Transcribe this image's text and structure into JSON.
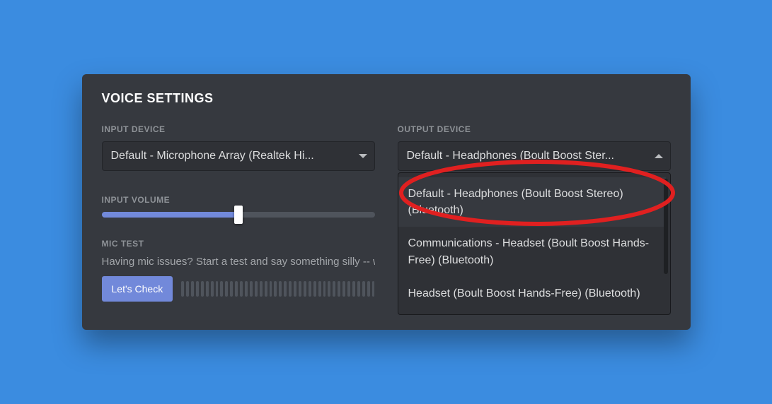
{
  "title": "VOICE SETTINGS",
  "input": {
    "label": "INPUT DEVICE",
    "selected": "Default - Microphone Array (Realtek Hi..."
  },
  "output": {
    "label": "OUTPUT DEVICE",
    "selected": "Default - Headphones (Boult Boost Ster...",
    "options": [
      "Default - Headphones (Boult Boost Stereo) (Bluetooth)",
      "Communications - Headset (Boult Boost Hands-Free) (Bluetooth)",
      "Headset (Boult Boost Hands-Free) (Bluetooth)"
    ]
  },
  "input_volume": {
    "label": "INPUT VOLUME",
    "percent": 50
  },
  "mic_test": {
    "label": "MIC TEST",
    "help": "Having mic issues? Start a test and say something silly -- w",
    "button": "Let's Check"
  },
  "colors": {
    "accent": "#7289da",
    "panel": "#36393f",
    "field": "#2f3136",
    "text": "#dcddde",
    "muted": "#8e9297",
    "annotation": "#e02020"
  }
}
